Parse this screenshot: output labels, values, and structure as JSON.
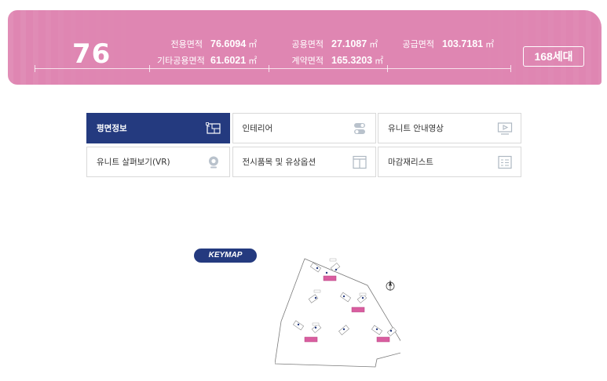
{
  "banner": {
    "type_number": "76",
    "stats": [
      {
        "label": "전용면적",
        "value": "76.6094",
        "unit": "㎡"
      },
      {
        "label": "공용면적",
        "value": "27.1087",
        "unit": "㎡"
      },
      {
        "label": "공급면적",
        "value": "103.7181",
        "unit": "㎡"
      },
      {
        "label": "기타공용면적",
        "value": "61.6021",
        "unit": "㎡"
      },
      {
        "label": "계약면적",
        "value": "165.3203",
        "unit": "㎡"
      }
    ],
    "households": "168세대",
    "colors": {
      "background": "#df86b2",
      "text": "#ffffff"
    }
  },
  "menu": {
    "items": [
      {
        "label": "평면정보",
        "icon": "floorplan-icon",
        "active": true
      },
      {
        "label": "인테리어",
        "icon": "toggle-switches-icon",
        "active": false
      },
      {
        "label": "유니트 안내영상",
        "icon": "video-play-icon",
        "active": false
      },
      {
        "label": "유니트 살펴보기(VR)",
        "icon": "vr-camera-icon",
        "active": false
      },
      {
        "label": "전시품목 및 유상옵션",
        "icon": "panel-layout-icon",
        "active": false
      },
      {
        "label": "마감재리스트",
        "icon": "checklist-icon",
        "active": false
      }
    ],
    "colors": {
      "active_bg": "#243a7f",
      "border": "#d9d9d9"
    }
  },
  "keymap": {
    "label": "KEYMAP",
    "icons": {
      "map": "site-plan-map",
      "compass": "north-compass-icon"
    },
    "colors": {
      "highlight": "#d95ea0",
      "tag_bg": "#243a7f"
    }
  }
}
